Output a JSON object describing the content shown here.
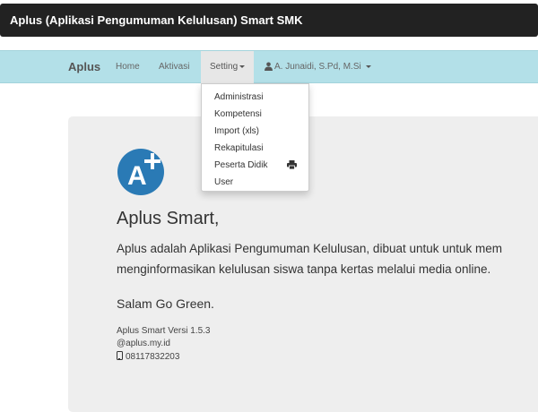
{
  "app": {
    "title": "Aplus (Aplikasi Pengumuman Kelulusan) Smart SMK"
  },
  "navbar": {
    "brand": "Aplus",
    "items": {
      "home": "Home",
      "aktivasi": "Aktivasi",
      "setting": "Setting"
    },
    "user": "A. Junaidi, S.Pd, M.Si"
  },
  "dropdown": {
    "items": [
      "Administrasi",
      "Kompetensi",
      "Import (xls)",
      "Rekapitulasi",
      "Peserta Didik",
      "User"
    ]
  },
  "main": {
    "heading": "Aplus Smart,",
    "desc_line1": "Aplus adalah Aplikasi Pengumuman Kelulusan, dibuat untuk untuk mem",
    "desc_line2": "menginformasikan kelulusan siswa tanpa kertas melalui media online.",
    "greeting": "Salam Go Green.",
    "version": "Aplus Smart Versi 1.5.3",
    "website": "@aplus.my.id",
    "phone": "08117832203"
  },
  "colors": {
    "navbar_bg": "#b3e0e8",
    "titlebar_bg": "#222222",
    "logo_blue": "#2a7ab5"
  }
}
